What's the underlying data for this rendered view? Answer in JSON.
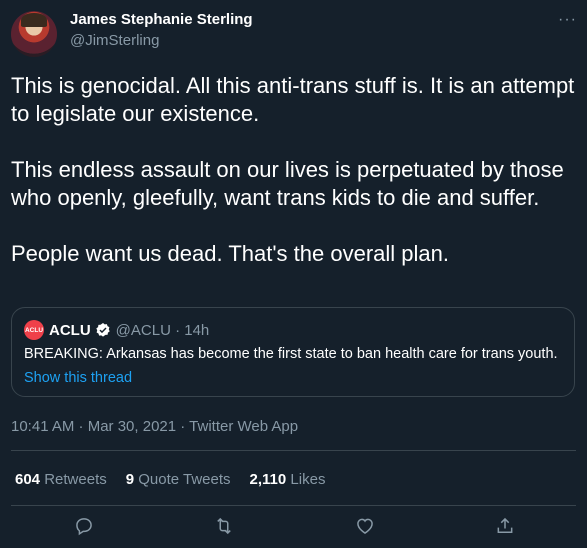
{
  "tweet": {
    "author_name": "James Stephanie Sterling",
    "author_handle": "@JimSterling",
    "more_glyph": "···",
    "paragraphs": [
      "This is genocidal. All this anti-trans stuff is. It is an attempt to legislate our existence.",
      "This endless assault on our lives is perpetuated by those who openly, gleefully, want trans kids to die and suffer.",
      "People want us dead. That's the overall plan."
    ],
    "timestamp": "10:41 AM · Mar 30, 2021 · Twitter Web App"
  },
  "quote": {
    "logo_text": "ACLU",
    "name": "ACLU",
    "meta": "@ACLU · 14h",
    "text": "BREAKING: Arkansas has become the first state to ban health care for trans youth.",
    "link": "Show this thread"
  },
  "stats": {
    "retweets_count": "604",
    "retweets_label": "Retweets",
    "quotes_count": "9",
    "quotes_label": "Quote Tweets",
    "likes_count": "2,110",
    "likes_label": "Likes"
  },
  "actions": [
    "reply-icon",
    "retweet-icon",
    "like-icon",
    "share-icon"
  ],
  "colors": {
    "background": "#15202b",
    "accent": "#1da1f2",
    "muted": "#8899a6",
    "aclu_red": "#ef404a"
  }
}
